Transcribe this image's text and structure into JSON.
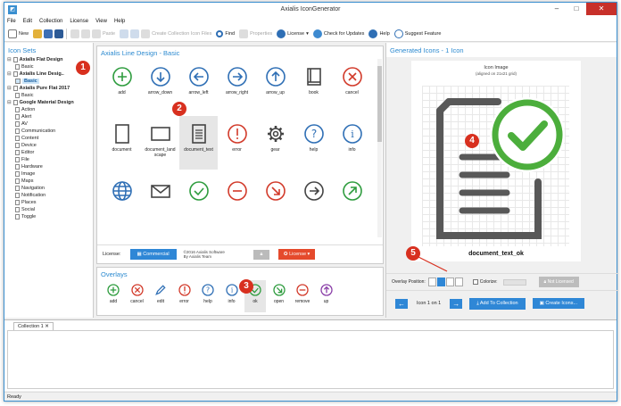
{
  "window": {
    "title": "Axialis IconGenerator",
    "app_icon": "app-logo-icon",
    "controls": {
      "minimize": "–",
      "maximize": "□",
      "close": "✕"
    }
  },
  "menu": [
    "File",
    "Edit",
    "Collection",
    "License",
    "View",
    "Help"
  ],
  "toolbar": {
    "new": "New",
    "paste": "Paste",
    "create_collection": "Create Collection Icon Files",
    "find": "Find",
    "properties": "Properties",
    "license": "License",
    "check_updates": "Check for Updates",
    "help": "Help",
    "suggest": "Suggest Feature"
  },
  "icon_sets": {
    "header": "Icon Sets",
    "items": [
      {
        "label": "Axialis Flat Design",
        "level": 0
      },
      {
        "label": "Basic",
        "level": 1
      },
      {
        "label": "Axialis Line Desig..",
        "level": 0
      },
      {
        "label": "Basic",
        "level": 1,
        "selected": true
      },
      {
        "label": "Axialis Pure Flat 2017",
        "level": 0
      },
      {
        "label": "Basic",
        "level": 1
      },
      {
        "label": "Google Material Design",
        "level": 0
      },
      {
        "label": "Action",
        "level": 1
      },
      {
        "label": "Alert",
        "level": 1
      },
      {
        "label": "AV",
        "level": 1
      },
      {
        "label": "Communication",
        "level": 1
      },
      {
        "label": "Content",
        "level": 1
      },
      {
        "label": "Device",
        "level": 1
      },
      {
        "label": "Editor",
        "level": 1
      },
      {
        "label": "File",
        "level": 1
      },
      {
        "label": "Hardware",
        "level": 1
      },
      {
        "label": "Image",
        "level": 1
      },
      {
        "label": "Maps",
        "level": 1
      },
      {
        "label": "Navigation",
        "level": 1
      },
      {
        "label": "Notification",
        "level": 1
      },
      {
        "label": "Places",
        "level": 1
      },
      {
        "label": "Social",
        "level": 1
      },
      {
        "label": "Toggle",
        "level": 1
      }
    ]
  },
  "icon_set_panel": {
    "title": "Axialis Line Design - Basic",
    "icons": [
      {
        "label": "add",
        "icon": "plus-circle-icon",
        "color": "#2e9c3e"
      },
      {
        "label": "arrow_down",
        "icon": "arrow-down-circle-icon",
        "color": "#2f6fb5"
      },
      {
        "label": "arrow_left",
        "icon": "arrow-left-circle-icon",
        "color": "#2f6fb5"
      },
      {
        "label": "arrow_right",
        "icon": "arrow-right-circle-icon",
        "color": "#2f6fb5"
      },
      {
        "label": "arrow_up",
        "icon": "arrow-up-circle-icon",
        "color": "#2f6fb5"
      },
      {
        "label": "book",
        "icon": "book-icon",
        "color": "#444"
      },
      {
        "label": "cancel",
        "icon": "x-circle-icon",
        "color": "#d23a2a"
      },
      {
        "label": "document",
        "icon": "document-icon",
        "color": "#444"
      },
      {
        "label": "document_land scape",
        "icon": "document-landscape-icon",
        "color": "#444"
      },
      {
        "label": "document_text",
        "icon": "document-text-icon",
        "color": "#444",
        "selected": true
      },
      {
        "label": "error",
        "icon": "exclamation-circle-icon",
        "color": "#d23a2a"
      },
      {
        "label": "gear",
        "icon": "gear-icon",
        "color": "#444"
      },
      {
        "label": "help",
        "icon": "question-circle-icon",
        "color": "#2f6fb5"
      },
      {
        "label": "info",
        "icon": "info-circle-icon",
        "color": "#2f6fb5"
      },
      {
        "label": "",
        "icon": "globe-icon",
        "color": "#2f6fb5"
      },
      {
        "label": "",
        "icon": "envelope-icon",
        "color": "#444"
      },
      {
        "label": "",
        "icon": "check-circle-icon",
        "color": "#2e9c3e"
      },
      {
        "label": "",
        "icon": "minus-circle-icon",
        "color": "#d23a2a"
      },
      {
        "label": "",
        "icon": "arrow-down-right-circle-icon",
        "color": "#d23a2a"
      },
      {
        "label": "",
        "icon": "arrow-right-circle-icon",
        "color": "#444"
      },
      {
        "label": "",
        "icon": "arrow-up-right-circle-icon",
        "color": "#2e9c3e"
      }
    ]
  },
  "license_bar": {
    "label": "License:",
    "commercial": "Commercial",
    "copyright_line1": "©2016 Axialis Software",
    "copyright_line2": "By Axialis Team",
    "license_btn": "License ▾"
  },
  "overlays": {
    "title": "Overlays",
    "items": [
      {
        "label": "add",
        "icon": "plus-circle-icon",
        "color": "#2e9c3e"
      },
      {
        "label": "cancel",
        "icon": "x-circle-icon",
        "color": "#d23a2a"
      },
      {
        "label": "edit",
        "icon": "pencil-icon",
        "color": "#2f6fb5"
      },
      {
        "label": "error",
        "icon": "exclamation-circle-icon",
        "color": "#d23a2a"
      },
      {
        "label": "help",
        "icon": "question-circle-icon",
        "color": "#2f6fb5"
      },
      {
        "label": "info",
        "icon": "info-circle-icon",
        "color": "#2f6fb5"
      },
      {
        "label": "ok",
        "icon": "check-circle-icon",
        "color": "#2e9c3e",
        "selected": true
      },
      {
        "label": "open",
        "icon": "arrow-down-right-circle-icon",
        "color": "#2e9c3e"
      },
      {
        "label": "remove",
        "icon": "minus-circle-icon",
        "color": "#d23a2a"
      },
      {
        "label": "up",
        "icon": "arrow-up-circle-icon",
        "color": "#8a3fa8"
      }
    ]
  },
  "generated": {
    "header": "Generated Icons - 1 Icon",
    "image_title": "Icon Image",
    "image_sub": "(aligned on 21x21 grid)",
    "icon_name": "document_text_ok",
    "overlay_position": "Overlay Position:",
    "colorize": "Colorize:",
    "not_licensed": "Not Licensed",
    "nav_text": "Icon 1 on 1",
    "add_collection": "Add To Collection",
    "create_icons": "Create Icons..."
  },
  "markers": [
    "1",
    "2",
    "3",
    "4",
    "5"
  ],
  "collection": {
    "tab": "Collection 1 ✕"
  },
  "status": "Ready",
  "colors": {
    "accent": "#2c8ad0",
    "marker": "#d8301f",
    "ok_green": "#4cae3c"
  }
}
